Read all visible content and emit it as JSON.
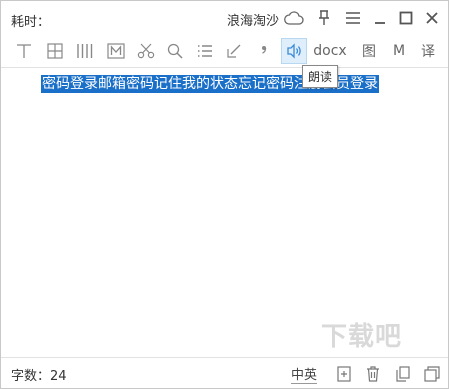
{
  "titlebar": {
    "elapsed_label": "耗时：",
    "username": "浪海淘沙",
    "icons": [
      "cloud-icon",
      "pin-icon",
      "menu-icon",
      "minimize-icon",
      "maximize-icon",
      "close-icon"
    ]
  },
  "toolbar": {
    "docx_label": "docx",
    "image_label": "图",
    "markdown_label": "M",
    "translate_label": "译",
    "read_tooltip": "朗读",
    "icons": [
      "text-format-icon",
      "table-icon",
      "columns-icon",
      "markdown-box-icon",
      "scissors-icon",
      "search-icon",
      "list-icon",
      "edit-icon",
      "comma-icon",
      "speaker-icon"
    ]
  },
  "editor": {
    "selected_text": "密码登录邮箱密码记住我的状态忘记密码注册会员登录"
  },
  "statusbar": {
    "word_count": "字数：24",
    "language": "中英",
    "icons": [
      "add-page-icon",
      "trash-icon",
      "copy-icon",
      "window-icon"
    ]
  },
  "watermark": "下载吧",
  "colors": {
    "selection": "#1a6fc9",
    "active_tool_bg": "#dfeefb"
  }
}
